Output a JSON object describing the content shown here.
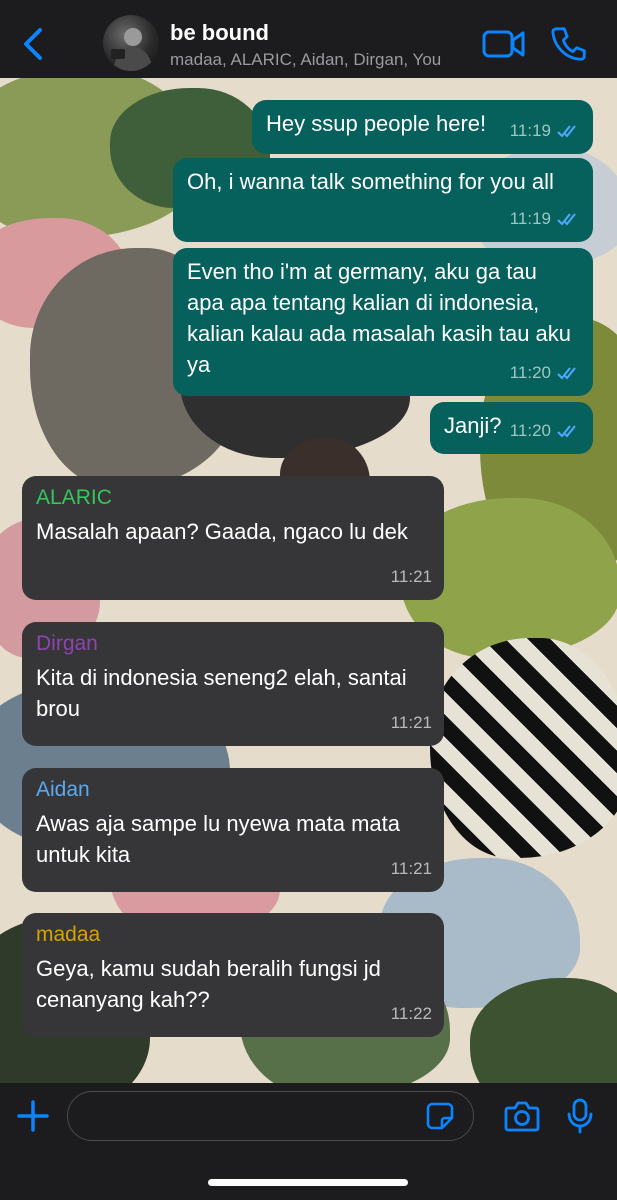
{
  "header": {
    "title": "be bound",
    "subtitle": "madaa, ALARIC, Aidan, Dirgan, You"
  },
  "messages": [
    {
      "dir": "out",
      "text": "Hey ssup people here!",
      "time": "11:19"
    },
    {
      "dir": "out",
      "text": "Oh, i wanna talk something for you all",
      "time": "11:19"
    },
    {
      "dir": "out",
      "text": "Even tho i'm at germany, aku ga tau apa apa tentang kalian di indonesia, kalian kalau ada masalah kasih tau aku ya",
      "time": "11:20"
    },
    {
      "dir": "out",
      "text": "Janji?",
      "time": "11:20"
    },
    {
      "dir": "in",
      "sender": "ALARIC",
      "sender_color": "#34c759",
      "text": "Masalah apaan? Gaada, ngaco lu dek",
      "time": "11:21"
    },
    {
      "dir": "in",
      "sender": "Dirgan",
      "sender_color": "#8e44ad",
      "text": "Kita di indonesia seneng2 elah, santai brou",
      "time": "11:21"
    },
    {
      "dir": "in",
      "sender": "Aidan",
      "sender_color": "#5aaaf0",
      "text": "Awas aja sampe lu nyewa mata mata untuk kita",
      "time": "11:21"
    },
    {
      "dir": "in",
      "sender": "madaa",
      "sender_color": "#d4a300",
      "text": "Geya, kamu sudah beralih fungsi jd cenanyang kah??",
      "time": "11:22"
    }
  ],
  "colors": {
    "accent": "#0a84ff",
    "outgoing_bubble": "#06605c",
    "incoming_bubble": "#363638",
    "read_ticks": "#4fa8ff"
  },
  "icons": {
    "back": "chevron-left-icon",
    "video": "video-camera-icon",
    "call": "phone-icon",
    "add": "plus-icon",
    "sticker": "sticker-icon",
    "camera": "camera-icon",
    "mic": "microphone-icon"
  },
  "input": {
    "placeholder": "",
    "value": ""
  }
}
